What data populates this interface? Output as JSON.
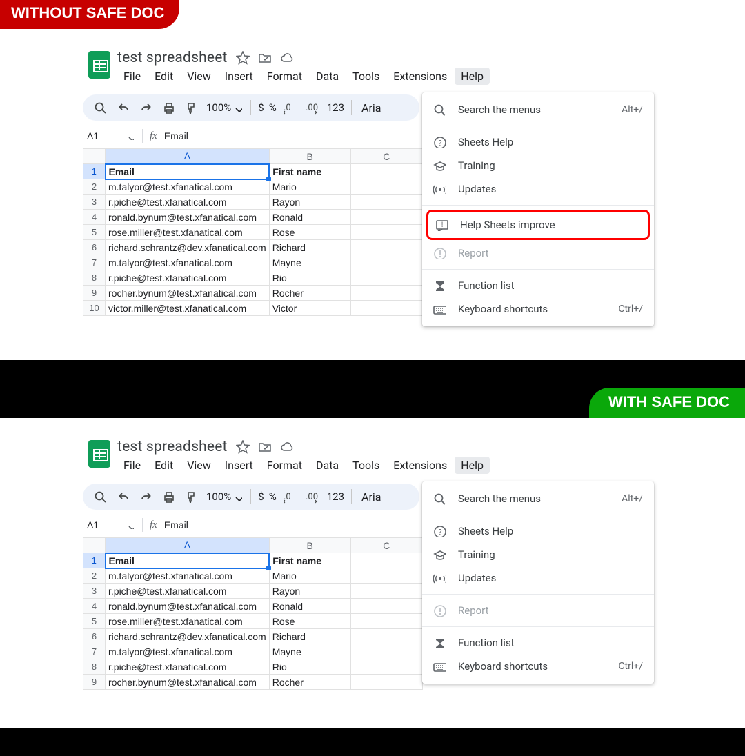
{
  "banners": {
    "without": "WITHOUT SAFE DOC",
    "with": "WITH SAFE DOC"
  },
  "doc_title": "test spreadsheet",
  "menubar": [
    "File",
    "Edit",
    "View",
    "Insert",
    "Format",
    "Data",
    "Tools",
    "Extensions",
    "Help"
  ],
  "toolbar": {
    "zoom": "100%",
    "dollar": "$",
    "percent": "%",
    "num123": "123",
    "font": "Aria"
  },
  "name_box": "A1",
  "fx_label": "fx",
  "formula_value": "Email",
  "columns": [
    "A",
    "B",
    "C"
  ],
  "headers": {
    "a": "Email",
    "b": "First name"
  },
  "rows_top": [
    {
      "n": "1",
      "a": "Email",
      "b": "First name",
      "sel": true,
      "bold": true
    },
    {
      "n": "2",
      "a": "m.talyor@test.xfanatical.com",
      "b": "Mario"
    },
    {
      "n": "3",
      "a": "r.piche@test.xfanatical.com",
      "b": "Rayon"
    },
    {
      "n": "4",
      "a": "ronald.bynum@test.xfanatical.com",
      "b": "Ronald"
    },
    {
      "n": "5",
      "a": "rose.miller@test.xfanatical.com",
      "b": "Rose"
    },
    {
      "n": "6",
      "a": "richard.schrantz@dev.xfanatical.com",
      "b": "Richard"
    },
    {
      "n": "7",
      "a": "m.talyor@test.xfanatical.com",
      "b": "Mayne"
    },
    {
      "n": "8",
      "a": "r.piche@test.xfanatical.com",
      "b": "Rio"
    },
    {
      "n": "9",
      "a": "rocher.bynum@test.xfanatical.com",
      "b": "Rocher"
    },
    {
      "n": "10",
      "a": "victor.miller@test.xfanatical.com",
      "b": "Victor"
    }
  ],
  "rows_bottom": [
    {
      "n": "1",
      "a": "Email",
      "b": "First name",
      "sel": true,
      "bold": true
    },
    {
      "n": "2",
      "a": "m.talyor@test.xfanatical.com",
      "b": "Mario"
    },
    {
      "n": "3",
      "a": "r.piche@test.xfanatical.com",
      "b": "Rayon"
    },
    {
      "n": "4",
      "a": "ronald.bynum@test.xfanatical.com",
      "b": "Ronald"
    },
    {
      "n": "5",
      "a": "rose.miller@test.xfanatical.com",
      "b": "Rose"
    },
    {
      "n": "6",
      "a": "richard.schrantz@dev.xfanatical.com",
      "b": "Richard"
    },
    {
      "n": "7",
      "a": "m.talyor@test.xfanatical.com",
      "b": "Mayne"
    },
    {
      "n": "8",
      "a": "r.piche@test.xfanatical.com",
      "b": "Rio"
    },
    {
      "n": "9",
      "a": "rocher.bynum@test.xfanatical.com",
      "b": "Rocher"
    }
  ],
  "help": {
    "search": "Search the menus",
    "search_short": "Alt+/",
    "sheets_help": "Sheets Help",
    "training": "Training",
    "updates": "Updates",
    "improve": "Help Sheets improve",
    "report": "Report",
    "functions": "Function list",
    "shortcuts": "Keyboard shortcuts",
    "shortcuts_short": "Ctrl+/"
  }
}
